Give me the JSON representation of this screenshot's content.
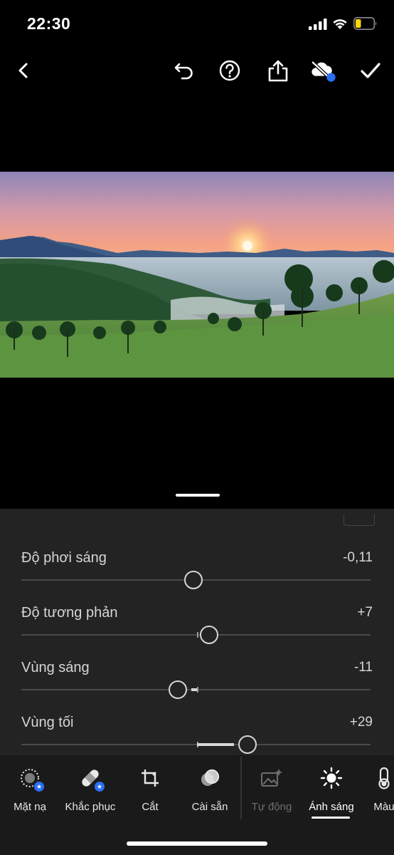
{
  "status_bar": {
    "time": "22:30",
    "signal_icon": "cellular-signal-icon",
    "wifi_icon": "wifi-icon",
    "battery_icon": "battery-low-icon",
    "battery_color": "#ffd60a"
  },
  "toolbar": {
    "back_icon": "chevron-left-icon",
    "undo_icon": "undo-icon",
    "help_icon": "help-circle-icon",
    "share_icon": "share-icon",
    "cloud_icon": "cloud-off-icon",
    "confirm_icon": "checkmark-icon",
    "accent_color": "#2a6ff2"
  },
  "photo": {
    "subject": "landscape-sunrise-hills"
  },
  "adjustments": [
    {
      "label": "Độ phơi sáng",
      "value": "-0,11",
      "level": -0.022
    },
    {
      "label": "Độ tương phản",
      "value": "+7",
      "level": 0.07
    },
    {
      "label": "Vùng sáng",
      "value": "-11",
      "level": -0.11
    },
    {
      "label": "Vùng tối",
      "value": "+29",
      "level": 0.29
    }
  ],
  "tools": [
    {
      "label": "Mặt nạ",
      "icon": "mask-icon",
      "premium": true
    },
    {
      "label": "Khắc phục",
      "icon": "bandage-icon",
      "premium": true
    },
    {
      "label": "Cắt",
      "icon": "crop-icon",
      "premium": false
    },
    {
      "label": "Cài sẵn",
      "icon": "presets-icon",
      "premium": false
    },
    {
      "label": "Tự động",
      "icon": "auto-icon",
      "premium": false
    },
    {
      "label": "Ánh sáng",
      "icon": "light-icon",
      "premium": false
    },
    {
      "label": "Màu",
      "icon": "color-icon",
      "premium": false
    }
  ],
  "active_tool": "Ánh sáng"
}
